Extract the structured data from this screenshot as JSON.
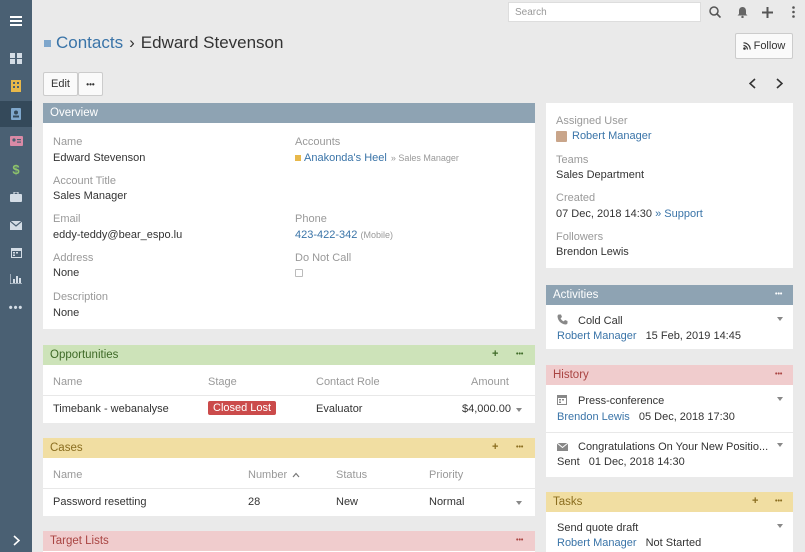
{
  "search": {
    "placeholder": "Search"
  },
  "sidebar_items": [
    "menu-icon",
    "dashboard-icon",
    "accounts-icon",
    "contacts-icon",
    "leads-icon",
    "opportunities-icon",
    "cases-icon",
    "email-icon",
    "calendar-icon",
    "reports-icon",
    "more-icon"
  ],
  "breadcrumb": {
    "parent": "Contacts",
    "separator": "›",
    "current": "Edward Stevenson"
  },
  "buttons": {
    "follow": "Follow",
    "edit": "Edit",
    "more": "•••"
  },
  "overview": {
    "title": "Overview",
    "name_label": "Name",
    "name_value": "Edward Stevenson",
    "accounts_label": "Accounts",
    "account_value": "Anakonda's Heel",
    "account_role": "» Sales Manager",
    "title_label": "Account Title",
    "title_value": "Sales Manager",
    "email_label": "Email",
    "email_value": "eddy-teddy@bear_espo.lu",
    "phone_label": "Phone",
    "phone_value": "423-422-342",
    "phone_type": "(Mobile)",
    "address_label": "Address",
    "address_value": "None",
    "dnc_label": "Do Not Call",
    "desc_label": "Description",
    "desc_value": "None"
  },
  "opportunities": {
    "title": "Opportunities",
    "cols": [
      "Name",
      "Stage",
      "Contact Role",
      "Amount"
    ],
    "row": {
      "name": "Timebank - webanalyse",
      "stage": "Closed Lost",
      "role": "Evaluator",
      "amount": "$4,000.00"
    }
  },
  "cases": {
    "title": "Cases",
    "cols": [
      "Name",
      "Number",
      "Status",
      "Priority"
    ],
    "row": {
      "name": "Password resetting",
      "number": "28",
      "status": "New",
      "priority": "Normal"
    }
  },
  "target_lists": {
    "title": "Target Lists"
  },
  "side": {
    "assigned_label": "Assigned User",
    "assigned_value": "Robert Manager",
    "teams_label": "Teams",
    "teams_value": "Sales Department",
    "created_label": "Created",
    "created_value": "07 Dec, 2018 14:30",
    "created_by": "» Support",
    "followers_label": "Followers",
    "followers_value": "Brendon Lewis"
  },
  "activities": {
    "title": "Activities",
    "item": {
      "title": "Cold Call",
      "user": "Robert Manager",
      "date": "15 Feb, 2019 14:45"
    }
  },
  "history": {
    "title": "History",
    "items": [
      {
        "title": "Press-conference",
        "user": "Brendon Lewis",
        "date": "05 Dec, 2018 17:30"
      },
      {
        "title": "Congratulations On Your New Positio...",
        "user": "Sent",
        "date": "01 Dec, 2018 14:30"
      }
    ]
  },
  "tasks": {
    "title": "Tasks",
    "item": {
      "title": "Send quote draft",
      "user": "Robert Manager",
      "status": "Not Started"
    }
  },
  "colors": {
    "overview": "#8ea3b3",
    "opportunities": "#cde3b9",
    "cases": "#f1dea2",
    "target_lists": "#f0cccd",
    "activities": "#8ea3b3",
    "history": "#f0cccd",
    "tasks": "#f1dea2"
  }
}
